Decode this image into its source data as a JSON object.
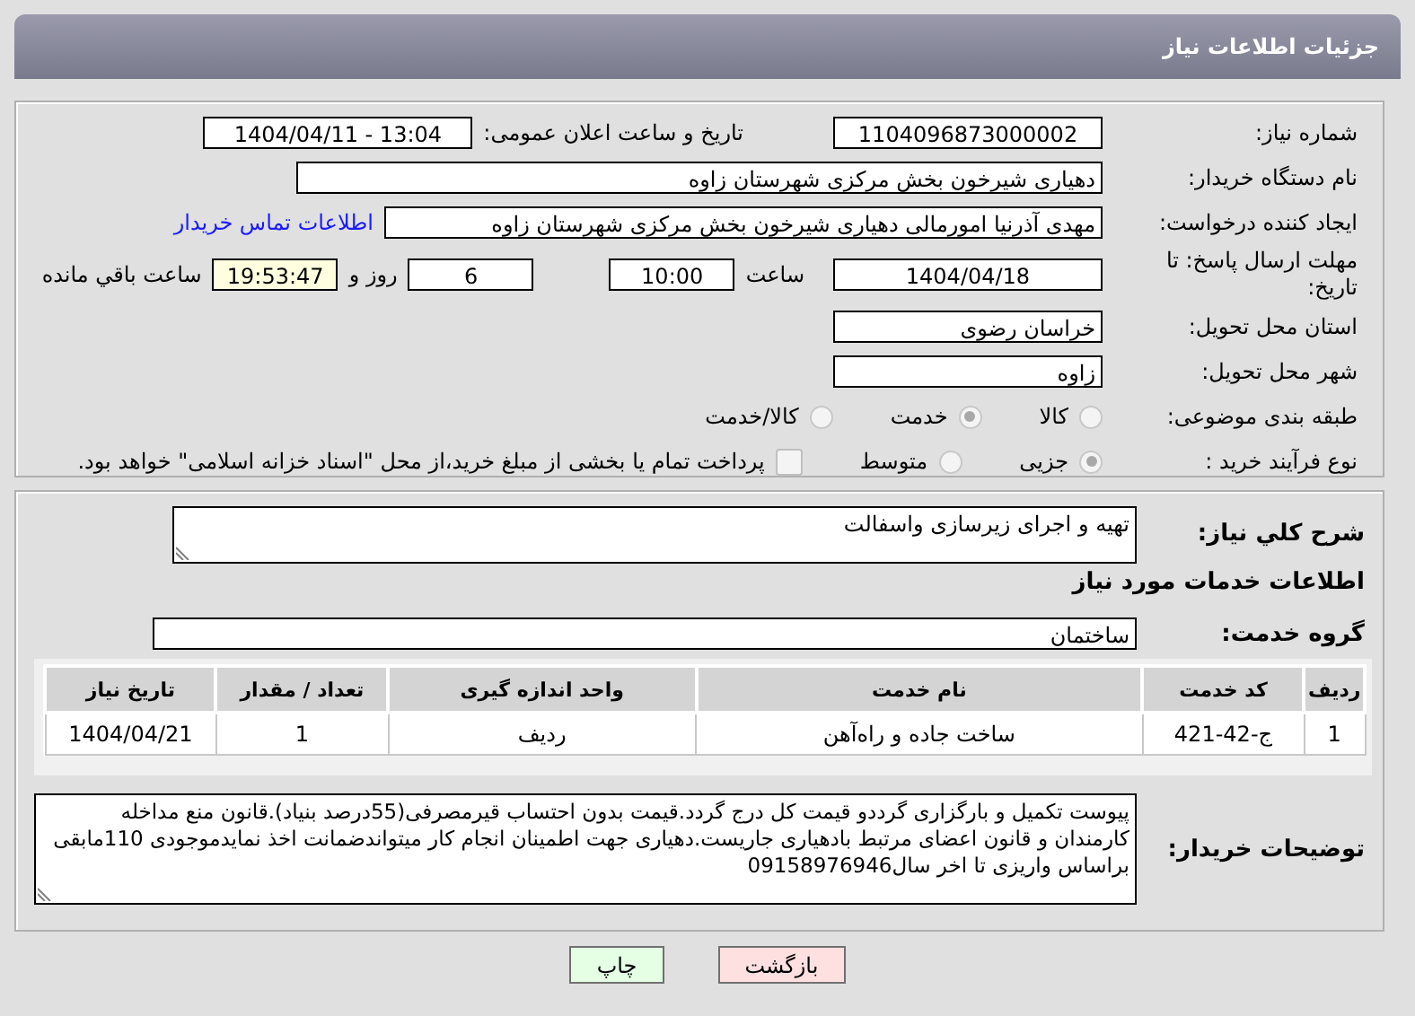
{
  "header": {
    "title": "جزئیات اطلاعات نیاز"
  },
  "details": {
    "need_number": {
      "label": "شماره نیاز:",
      "value": "1104096873000002"
    },
    "announce": {
      "label": "تاریخ و ساعت اعلان عمومی:",
      "value": "1404/04/11 - 13:04"
    },
    "buyer_org": {
      "label": "نام دستگاه خریدار:",
      "value": "دهیاری شیرخون بخش مرکزی شهرستان زاوه"
    },
    "requester": {
      "label": "ایجاد کننده درخواست:",
      "value": "مهدی آذرنیا امورمالی دهیاری شیرخون بخش مرکزی شهرستان زاوه",
      "link": "اطلاعات تماس خریدار"
    },
    "deadline": {
      "label": "مهلت ارسال پاسخ: تا تاریخ:",
      "date": "1404/04/18",
      "time_label": "ساعت",
      "time": "10:00",
      "days": "6",
      "days_label": "روز و",
      "remaining": "19:53:47",
      "remaining_label": "ساعت باقي مانده"
    },
    "province": {
      "label": "استان محل تحویل:",
      "value": "خراسان رضوی"
    },
    "city": {
      "label": "شهر محل تحویل:",
      "value": "زاوه"
    },
    "category": {
      "label": "طبقه بندی موضوعی:",
      "options": [
        {
          "label": "کالا",
          "selected": false
        },
        {
          "label": "خدمت",
          "selected": true
        },
        {
          "label": "کالا/خدمت",
          "selected": false
        }
      ]
    },
    "process": {
      "label": "نوع فرآیند خرید :",
      "options": [
        {
          "label": "جزیی",
          "selected": true
        },
        {
          "label": "متوسط",
          "selected": false
        }
      ],
      "treasury": {
        "checked": false,
        "label": "پرداخت تمام یا بخشی از مبلغ خرید،از محل \"اسناد خزانه اسلامی\" خواهد بود."
      }
    }
  },
  "need": {
    "description": {
      "label": "شرح کلي نياز:",
      "value": "تهیه و اجرای زیرسازی واسفالت"
    },
    "services_heading": "اطلاعات خدمات مورد نیاز",
    "service_group": {
      "label": "گروه خدمت:",
      "value": "ساختمان"
    },
    "table": {
      "columns": [
        "ردیف",
        "کد خدمت",
        "نام خدمت",
        "واحد اندازه گیری",
        "تعداد / مقدار",
        "تاریخ نیاز"
      ],
      "rows": [
        [
          "1",
          "ج-42-421",
          "ساخت جاده و راه‌آهن",
          "ردیف",
          "1",
          "1404/04/21"
        ]
      ]
    },
    "buyer_notes": {
      "label": "توضیحات خریدار:",
      "value": "پیوست تکمیل و بارگزاری گرددو قیمت کل درج گردد.قیمت بدون احتساب قیرمصرفی(55درصد بنیاد).قانون منع مداخله کارمندان و قانون اعضای مرتبط بادهیاری جاریست.دهیاری جهت اطمینان انجام کار میتواندضمانت اخذ نمایدموجودی 110مابقی براساس واریزی تا اخر سال09158976946"
    }
  },
  "buttons": [
    {
      "label": "بازگشت",
      "kind": "back"
    },
    {
      "label": "چاپ",
      "kind": "print"
    }
  ]
}
